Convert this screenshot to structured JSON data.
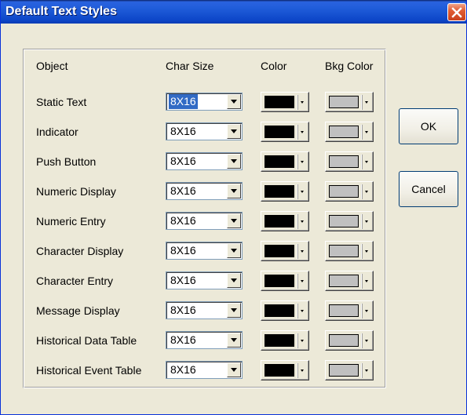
{
  "window": {
    "title": "Default Text Styles",
    "close_icon": "close-x-icon",
    "colors": {
      "titlebar": "#1e5bd8",
      "close": "#e15d34",
      "face": "#ece9d8"
    }
  },
  "table": {
    "headers": {
      "object": "Object",
      "char_size": "Char Size",
      "color": "Color",
      "bkg_color": "Bkg Color"
    },
    "rows": [
      {
        "object": "Static Text",
        "char_size": "8X16",
        "color": "#000000",
        "bkg_color": "#c0c0c0",
        "selected": true
      },
      {
        "object": "Indicator",
        "char_size": "8X16",
        "color": "#000000",
        "bkg_color": "#c0c0c0"
      },
      {
        "object": "Push Button",
        "char_size": "8X16",
        "color": "#000000",
        "bkg_color": "#c0c0c0"
      },
      {
        "object": "Numeric Display",
        "char_size": "8X16",
        "color": "#000000",
        "bkg_color": "#c0c0c0"
      },
      {
        "object": "Numeric Entry",
        "char_size": "8X16",
        "color": "#000000",
        "bkg_color": "#c0c0c0"
      },
      {
        "object": "Character Display",
        "char_size": "8X16",
        "color": "#000000",
        "bkg_color": "#c0c0c0"
      },
      {
        "object": "Character Entry",
        "char_size": "8X16",
        "color": "#000000",
        "bkg_color": "#c0c0c0"
      },
      {
        "object": "Message Display",
        "char_size": "8X16",
        "color": "#000000",
        "bkg_color": "#c0c0c0"
      },
      {
        "object": "Historical Data Table",
        "char_size": "8X16",
        "color": "#000000",
        "bkg_color": "#c0c0c0"
      },
      {
        "object": "Historical Event Table",
        "char_size": "8X16",
        "color": "#000000",
        "bkg_color": "#c0c0c0"
      }
    ]
  },
  "buttons": {
    "ok": "OK",
    "cancel": "Cancel"
  }
}
